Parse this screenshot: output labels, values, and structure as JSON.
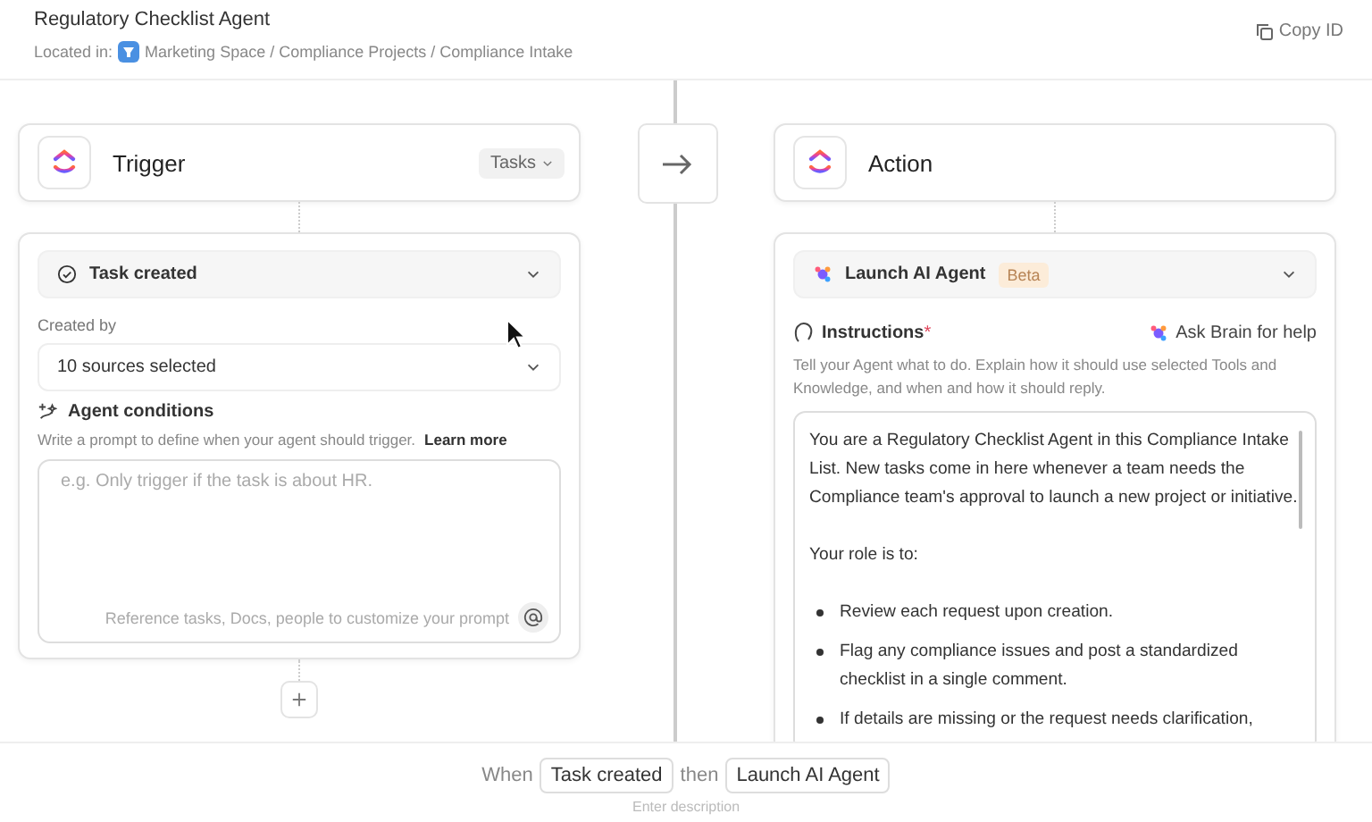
{
  "header": {
    "title": "Regulatory Checklist Agent",
    "location_label": "Located in:",
    "location_path": "Marketing Space / Compliance Projects / Compliance Intake",
    "copy_button": "Copy ID"
  },
  "trigger": {
    "title": "Trigger",
    "type_dropdown": "Tasks",
    "event": "Task created",
    "created_by_label": "Created by",
    "created_by_value": "10 sources selected",
    "conditions_title": "Agent conditions",
    "conditions_hint": "Write a prompt to define when your agent should trigger.",
    "learn_more": "Learn more",
    "prompt_placeholder": "e.g. Only trigger if the task is about HR.",
    "prompt_footer": "Reference tasks, Docs, people to customize your prompt"
  },
  "action": {
    "title": "Action",
    "step": "Launch AI Agent",
    "badge": "Beta",
    "instructions_label": "Instructions",
    "required_mark": "*",
    "ask_brain": "Ask Brain for help",
    "instructions_hint": "Tell your Agent what to do. Explain how it should use selected Tools and Knowledge, and when and how it should reply.",
    "instructions": [
      {
        "kind": "paragraph",
        "text": "You are a Regulatory Checklist Agent in this Compliance Intake List. New tasks come in here whenever a team needs the Compliance team's approval to launch a new project or initiative."
      },
      {
        "kind": "paragraph",
        "text": "Your role is to:"
      },
      {
        "kind": "bullet",
        "text": "Review each request upon creation."
      },
      {
        "kind": "bullet",
        "text": "Flag any compliance issues and post a standardized checklist in a single comment."
      },
      {
        "kind": "bullet",
        "text": "If details are missing or the request needs clarification,"
      }
    ]
  },
  "summary": {
    "when": "When",
    "trigger": "Task created",
    "then": "then",
    "action": "Launch AI Agent",
    "description_placeholder": "Enter description"
  }
}
